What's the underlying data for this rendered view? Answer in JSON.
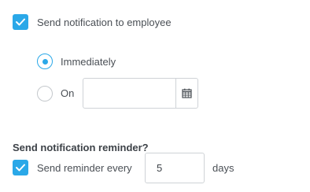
{
  "notification": {
    "checkbox_label": "Send notification to employee",
    "checked": true,
    "options": {
      "immediately_label": "Immediately",
      "on_label": "On",
      "selected": "immediately",
      "date_value": "",
      "calendar_icon": "calendar-icon"
    }
  },
  "reminder": {
    "heading": "Send notification reminder?",
    "checkbox_label": "Send reminder every",
    "checked": true,
    "days_value": "5",
    "unit_label": "days"
  },
  "colors": {
    "accent": "#2aa8e8",
    "border": "#cfd3d7",
    "text": "#4a4f55"
  }
}
